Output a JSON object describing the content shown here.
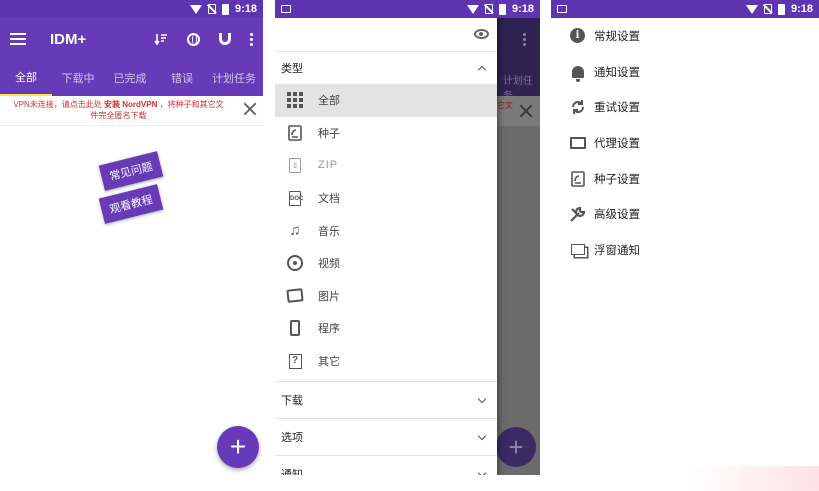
{
  "status_bar": {
    "time": "9:18"
  },
  "screen1": {
    "app_title": "IDM+",
    "appbar_icons": [
      "sort-icon",
      "browser-icon",
      "magnet-icon",
      "more-icon"
    ],
    "tabs": [
      "全部",
      "下载中",
      "已完成",
      "错误",
      "计划任务"
    ],
    "active_tab": 0,
    "vpn_banner": {
      "line1_prefix": "VPN未连接，请点击此处",
      "line1_bold": "安装 NordVPN",
      "line1_suffix": "，将种子和其它文",
      "line2": "件完全匿名下载"
    },
    "faq_button": "常见问题",
    "tutorial_button": "观看教程",
    "fab_symbol": "+"
  },
  "screen2": {
    "bg_tab_fragment": "计划任务",
    "bg_banner_fragment": "它文",
    "category_header": "类型",
    "categories": [
      {
        "label": "全部",
        "icon": "grid-icon",
        "active": true
      },
      {
        "label": "种子",
        "icon": "torrent-icon"
      },
      {
        "label": "ZIP",
        "icon": "zip-icon",
        "disabled": true
      },
      {
        "label": "文档",
        "icon": "document-icon"
      },
      {
        "label": "音乐",
        "icon": "music-icon"
      },
      {
        "label": "视频",
        "icon": "video-icon"
      },
      {
        "label": "图片",
        "icon": "image-icon"
      },
      {
        "label": "程序",
        "icon": "app-icon"
      },
      {
        "label": "其它",
        "icon": "other-icon"
      }
    ],
    "sections": [
      "下载",
      "选项",
      "通知"
    ],
    "fab_symbol": "+"
  },
  "screen3": {
    "menu": [
      {
        "label": "常规设置",
        "icon": "info-icon"
      },
      {
        "label": "通知设置",
        "icon": "bell-icon"
      },
      {
        "label": "重试设置",
        "icon": "refresh-icon"
      },
      {
        "label": "代理设置",
        "icon": "proxy-icon"
      },
      {
        "label": "种子设置",
        "icon": "torrent-icon"
      },
      {
        "label": "高级设置",
        "icon": "wrench-icon"
      },
      {
        "label": "浮窗通知",
        "icon": "floating-window-icon"
      }
    ]
  },
  "colors": {
    "primary": "#673ab7",
    "status_bar": "#5e35b1",
    "tab_indicator": "#ffeb3b",
    "banner_text": "#d32f2f"
  }
}
